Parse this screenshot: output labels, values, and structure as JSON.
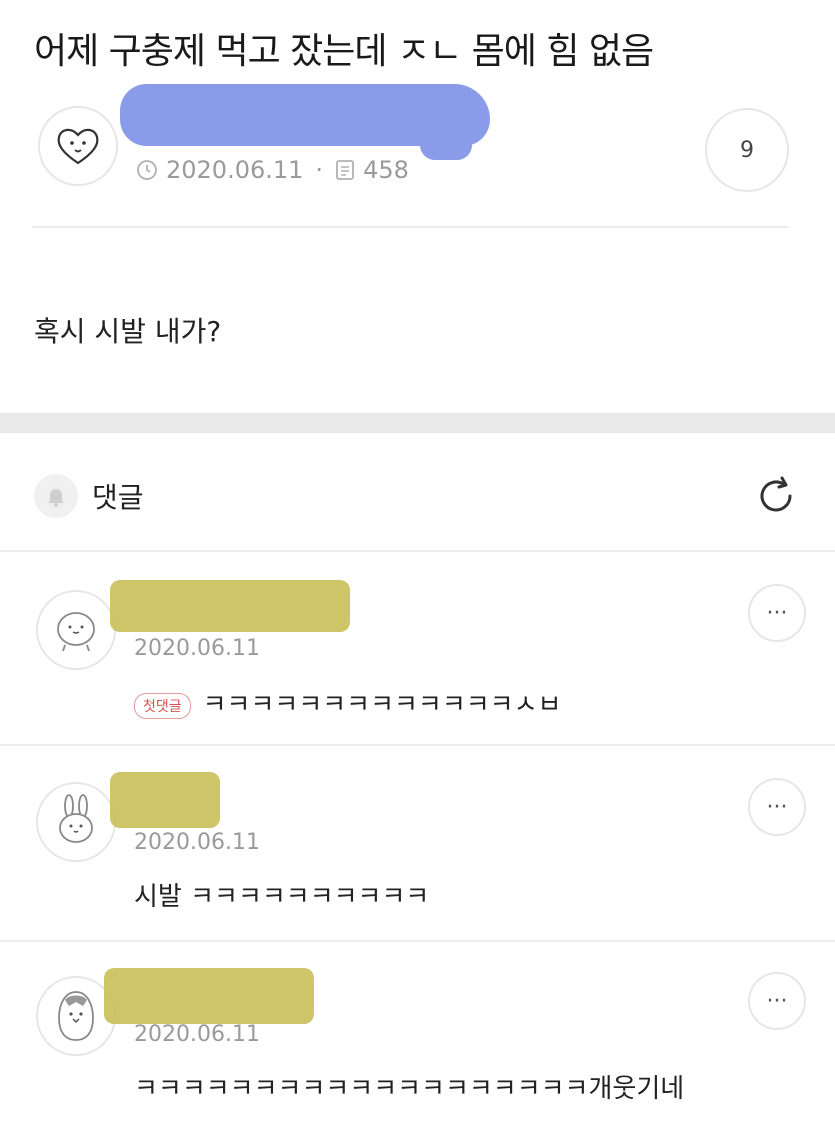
{
  "post": {
    "title": "어제 구충제 먹고 잤는데 ㅈㄴ 몸에 힘 없음",
    "date": "2020.06.11",
    "views": "458",
    "comment_count": "9",
    "body": "혹시 시발 내가?"
  },
  "comments_section": {
    "label": "댓글"
  },
  "comments": [
    {
      "date": "2020.06.11",
      "badge": "첫댓글",
      "text": "ㅋㅋㅋㅋㅋㅋㅋㅋㅋㅋㅋㅋㅋㅅㅂ",
      "avatar_icon": "round-face-icon"
    },
    {
      "date": "2020.06.11",
      "text": "시발 ㅋㅋㅋㅋㅋㅋㅋㅋㅋㅋ",
      "avatar_icon": "bunny-icon"
    },
    {
      "date": "2020.06.11",
      "text": "ㅋㅋㅋㅋㅋㅋㅋㅋㅋㅋㅋㅋㅋㅋㅋㅋㅋㅋㅋ개웃기네",
      "avatar_icon": "penguin-icon"
    }
  ],
  "colors": {
    "redaction_blue": "#8a9bea",
    "redaction_yellow": "#c9c05b",
    "badge_red": "#d9534f"
  }
}
